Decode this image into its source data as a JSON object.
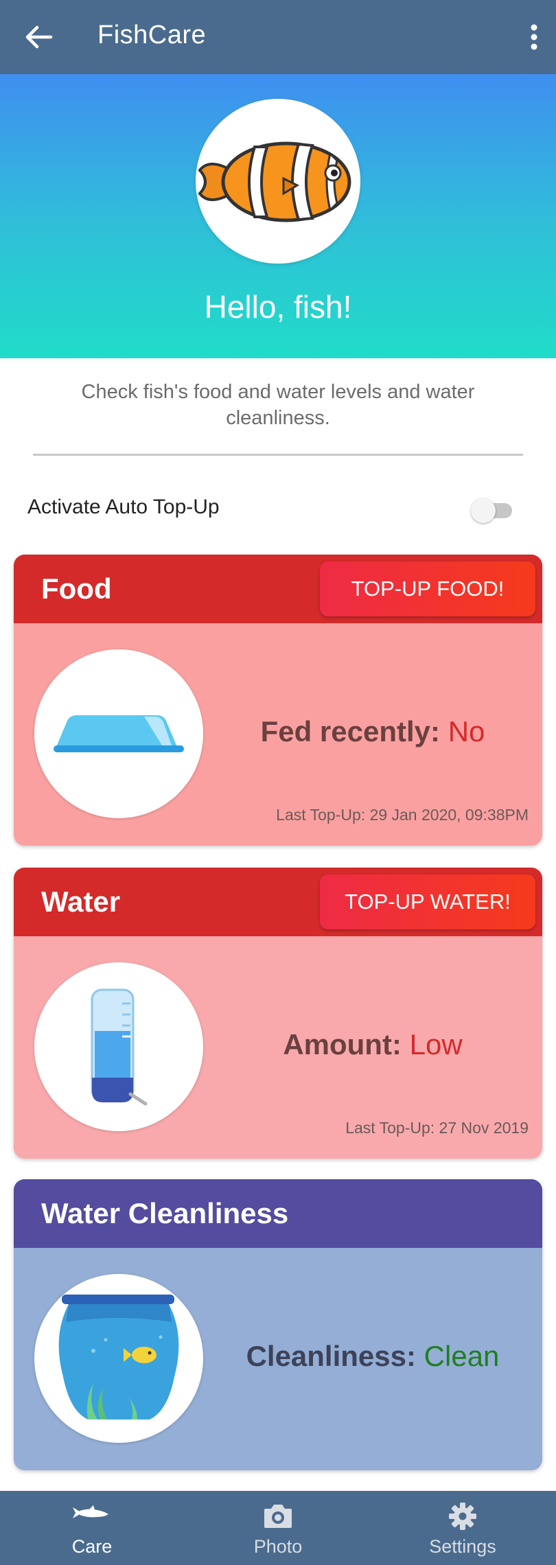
{
  "appbar": {
    "title": "FishCare"
  },
  "hero": {
    "greeting": "Hello, fish!"
  },
  "description": "Check fish's food and water levels and water cleanliness.",
  "auto_topup": {
    "label": "Activate Auto Top-Up",
    "enabled": false
  },
  "cards": {
    "food": {
      "title": "Food",
      "button": "TOP-UP FOOD!",
      "metric_label": "Fed recently:",
      "metric_value": "No",
      "last_topup": "Last Top-Up: 29 Jan 2020, 09:38PM",
      "status_color": "#d42a2a",
      "icon": "food-bowl-icon"
    },
    "water": {
      "title": "Water",
      "button": "TOP-UP WATER!",
      "metric_label": "Amount:",
      "metric_value": "Low",
      "last_topup": "Last Top-Up: 27 Nov 2019",
      "status_color": "#d42a2a",
      "icon": "water-bottle-icon"
    },
    "cleanliness": {
      "title": "Water Cleanliness",
      "metric_label": "Cleanliness:",
      "metric_value": "Clean",
      "status_color": "#1f7f1f",
      "icon": "fishbowl-icon"
    }
  },
  "bottom_nav": {
    "items": [
      {
        "label": "Care",
        "icon": "fish-icon",
        "active": true
      },
      {
        "label": "Photo",
        "icon": "camera-icon",
        "active": false
      },
      {
        "label": "Settings",
        "icon": "gear-icon",
        "active": false
      }
    ]
  },
  "colors": {
    "appbar": "#4a6b8e",
    "food_header": "#d42a2a",
    "cleanliness_header": "#534c9f"
  }
}
